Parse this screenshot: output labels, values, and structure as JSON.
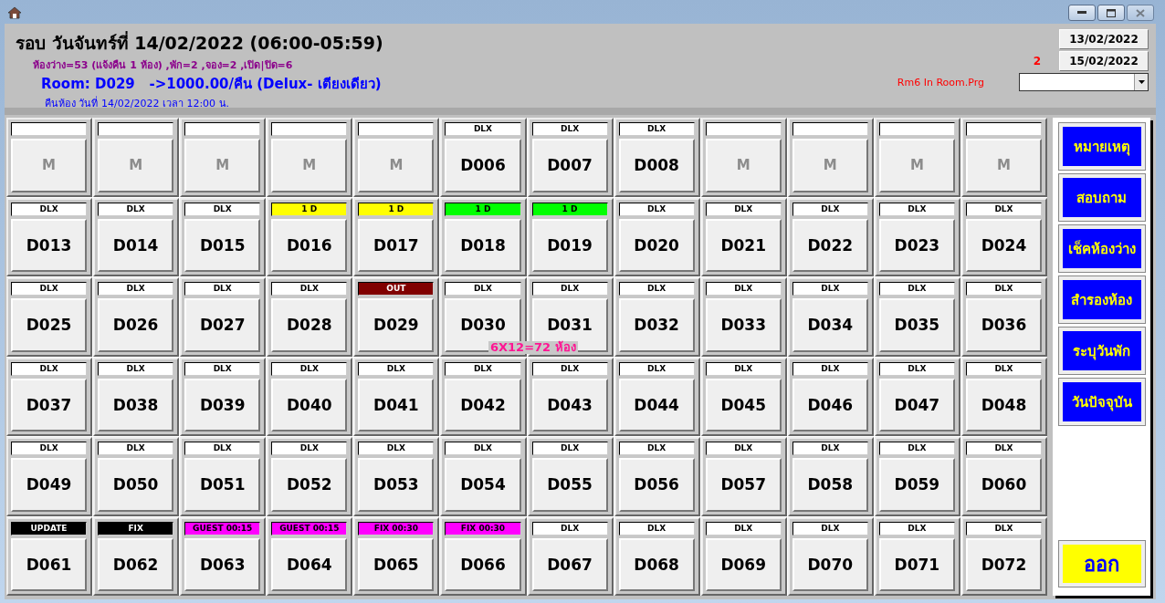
{
  "header": {
    "title": "รอบ วันจันทร์ที่ 14/02/2022 (06:00-05:59)",
    "stats": "ห้องว่าง=53 (แจ้งคืน 1 ห้อง) ,พัก=2 ,จอง=2 ,เปิด|ปิด=6",
    "room_info": "Room: D029   ->1000.00/คืน (Delux- เตียงเดียว)",
    "checkout": "คืนห้อง วันที่ 14/02/2022 เวลา 12:00 น.",
    "program": "Rm6 In Room.Prg",
    "count": "2",
    "date_buttons": [
      "13/02/2022",
      "15/02/2022"
    ]
  },
  "rooms": [
    {
      "label": "M",
      "disabled": true,
      "color": "#ffffff"
    },
    {
      "label": "M",
      "disabled": true,
      "color": "#ffffff"
    },
    {
      "label": "M",
      "disabled": true,
      "color": "#ffffff"
    },
    {
      "label": "M",
      "disabled": true,
      "color": "#ffffff"
    },
    {
      "label": "M",
      "disabled": true,
      "color": "#ffffff"
    },
    {
      "tag": "DLX",
      "label": "D006",
      "disabled": false,
      "color": "#ffffff"
    },
    {
      "tag": "DLX",
      "label": "D007",
      "disabled": false,
      "color": "#ffffff"
    },
    {
      "tag": "DLX",
      "label": "D008",
      "disabled": false,
      "color": "#ffffff"
    },
    {
      "label": "M",
      "disabled": true,
      "color": "#ffffff"
    },
    {
      "label": "M",
      "disabled": true,
      "color": "#ffffff"
    },
    {
      "label": "M",
      "disabled": true,
      "color": "#ffffff"
    },
    {
      "label": "M",
      "disabled": true,
      "color": "#ffffff"
    },
    {
      "tag": "DLX",
      "label": "D013",
      "disabled": false,
      "color": "#ffffff"
    },
    {
      "tag": "DLX",
      "label": "D014",
      "disabled": false,
      "color": "#ffffff"
    },
    {
      "tag": "DLX",
      "label": "D015",
      "disabled": false,
      "color": "#ffffff"
    },
    {
      "tag": "1 D",
      "label": "D016",
      "disabled": false,
      "color": "#ffff00"
    },
    {
      "tag": "1 D",
      "label": "D017",
      "disabled": false,
      "color": "#ffff00"
    },
    {
      "tag": "1 D",
      "label": "D018",
      "disabled": false,
      "color": "#00ff00"
    },
    {
      "tag": "1 D",
      "label": "D019",
      "disabled": false,
      "color": "#00ff00"
    },
    {
      "tag": "DLX",
      "label": "D020",
      "disabled": false,
      "color": "#ffffff"
    },
    {
      "tag": "DLX",
      "label": "D021",
      "disabled": false,
      "color": "#ffffff"
    },
    {
      "tag": "DLX",
      "label": "D022",
      "disabled": false,
      "color": "#ffffff"
    },
    {
      "tag": "DLX",
      "label": "D023",
      "disabled": false,
      "color": "#ffffff"
    },
    {
      "tag": "DLX",
      "label": "D024",
      "disabled": false,
      "color": "#ffffff"
    },
    {
      "tag": "DLX",
      "label": "D025",
      "disabled": false,
      "color": "#ffffff"
    },
    {
      "tag": "DLX",
      "label": "D026",
      "disabled": false,
      "color": "#ffffff"
    },
    {
      "tag": "DLX",
      "label": "D027",
      "disabled": false,
      "color": "#ffffff"
    },
    {
      "tag": "DLX",
      "label": "D028",
      "disabled": false,
      "color": "#ffffff"
    },
    {
      "tag": "OUT",
      "label": "D029",
      "disabled": false,
      "color": "#800000"
    },
    {
      "tag": "DLX",
      "label": "D030",
      "disabled": false,
      "color": "#ffffff"
    },
    {
      "tag": "DLX",
      "label": "D031",
      "disabled": false,
      "color": "#ffffff"
    },
    {
      "tag": "DLX",
      "label": "D032",
      "disabled": false,
      "color": "#ffffff"
    },
    {
      "tag": "DLX",
      "label": "D033",
      "disabled": false,
      "color": "#ffffff"
    },
    {
      "tag": "DLX",
      "label": "D034",
      "disabled": false,
      "color": "#ffffff"
    },
    {
      "tag": "DLX",
      "label": "D035",
      "disabled": false,
      "color": "#ffffff"
    },
    {
      "tag": "DLX",
      "label": "D036",
      "disabled": false,
      "color": "#ffffff"
    },
    {
      "tag": "DLX",
      "label": "D037",
      "disabled": false,
      "color": "#ffffff"
    },
    {
      "tag": "DLX",
      "label": "D038",
      "disabled": false,
      "color": "#ffffff"
    },
    {
      "tag": "DLX",
      "label": "D039",
      "disabled": false,
      "color": "#ffffff"
    },
    {
      "tag": "DLX",
      "label": "D040",
      "disabled": false,
      "color": "#ffffff"
    },
    {
      "tag": "DLX",
      "label": "D041",
      "disabled": false,
      "color": "#ffffff"
    },
    {
      "tag": "DLX",
      "label": "D042",
      "disabled": false,
      "color": "#ffffff"
    },
    {
      "tag": "DLX",
      "label": "D043",
      "disabled": false,
      "color": "#ffffff"
    },
    {
      "tag": "DLX",
      "label": "D044",
      "disabled": false,
      "color": "#ffffff"
    },
    {
      "tag": "DLX",
      "label": "D045",
      "disabled": false,
      "color": "#ffffff"
    },
    {
      "tag": "DLX",
      "label": "D046",
      "disabled": false,
      "color": "#ffffff"
    },
    {
      "tag": "DLX",
      "label": "D047",
      "disabled": false,
      "color": "#ffffff"
    },
    {
      "tag": "DLX",
      "label": "D048",
      "disabled": false,
      "color": "#ffffff"
    },
    {
      "tag": "DLX",
      "label": "D049",
      "disabled": false,
      "color": "#ffffff"
    },
    {
      "tag": "DLX",
      "label": "D050",
      "disabled": false,
      "color": "#ffffff"
    },
    {
      "tag": "DLX",
      "label": "D051",
      "disabled": false,
      "color": "#ffffff"
    },
    {
      "tag": "DLX",
      "label": "D052",
      "disabled": false,
      "color": "#ffffff"
    },
    {
      "tag": "DLX",
      "label": "D053",
      "disabled": false,
      "color": "#ffffff"
    },
    {
      "tag": "DLX",
      "label": "D054",
      "disabled": false,
      "color": "#ffffff"
    },
    {
      "tag": "DLX",
      "label": "D055",
      "disabled": false,
      "color": "#ffffff"
    },
    {
      "tag": "DLX",
      "label": "D056",
      "disabled": false,
      "color": "#ffffff"
    },
    {
      "tag": "DLX",
      "label": "D057",
      "disabled": false,
      "color": "#ffffff"
    },
    {
      "tag": "DLX",
      "label": "D058",
      "disabled": false,
      "color": "#ffffff"
    },
    {
      "tag": "DLX",
      "label": "D059",
      "disabled": false,
      "color": "#ffffff"
    },
    {
      "tag": "DLX",
      "label": "D060",
      "disabled": false,
      "color": "#ffffff"
    },
    {
      "tag": "UPDATE",
      "label": "D061",
      "disabled": false,
      "color": "#000000"
    },
    {
      "tag": "FIX",
      "label": "D062",
      "disabled": false,
      "color": "#000000"
    },
    {
      "tag": "GUEST 00:15",
      "label": "D063",
      "disabled": false,
      "color": "#ff00ff"
    },
    {
      "tag": "GUEST 00:15",
      "label": "D064",
      "disabled": false,
      "color": "#ff00ff"
    },
    {
      "tag": "FIX 00:30",
      "label": "D065",
      "disabled": false,
      "color": "#ff00ff"
    },
    {
      "tag": "FIX 00:30",
      "label": "D066",
      "disabled": false,
      "color": "#ff00ff"
    },
    {
      "tag": "DLX",
      "label": "D067",
      "disabled": false,
      "color": "#ffffff"
    },
    {
      "tag": "DLX",
      "label": "D068",
      "disabled": false,
      "color": "#ffffff"
    },
    {
      "tag": "DLX",
      "label": "D069",
      "disabled": false,
      "color": "#ffffff"
    },
    {
      "tag": "DLX",
      "label": "D070",
      "disabled": false,
      "color": "#ffffff"
    },
    {
      "tag": "DLX",
      "label": "D071",
      "disabled": false,
      "color": "#ffffff"
    },
    {
      "tag": "DLX",
      "label": "D072",
      "disabled": false,
      "color": "#ffffff"
    }
  ],
  "grid_note": "6X12=72 ห้อง",
  "side_buttons": [
    "หมายเหตุ",
    "สอบถาม",
    "เช็คห้องว่าง",
    "สำรองห้อง",
    "ระบุวันพัก",
    "วันปัจจุบัน"
  ],
  "exit_button": "ออก"
}
